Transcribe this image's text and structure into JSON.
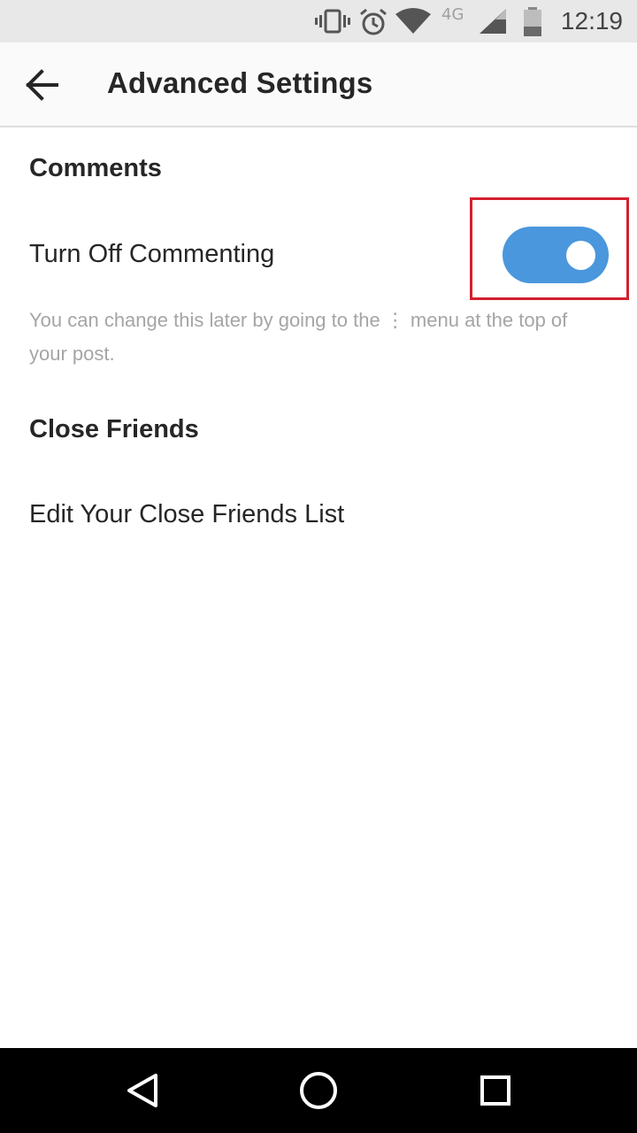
{
  "status_bar": {
    "network_label": "4G",
    "time": "12:19",
    "icons": [
      "vibrate-icon",
      "alarm-icon",
      "wifi-icon",
      "cell-signal-icon",
      "battery-icon"
    ]
  },
  "app_bar": {
    "title": "Advanced Settings",
    "back_icon": "back-arrow-icon"
  },
  "comments": {
    "header": "Comments",
    "turn_off_commenting": {
      "label": "Turn Off Commenting",
      "enabled": true
    },
    "helper_text": "You can change this later by going to the ⋮ menu at the top of your post."
  },
  "close_friends": {
    "header": "Close Friends",
    "edit_list_label": "Edit Your Close Friends List"
  },
  "colors": {
    "toggle_on": "#4a97dd",
    "highlight": "#d32030",
    "text_primary": "#262626",
    "text_secondary": "#a5a5a5"
  },
  "nav_bar": {
    "icons": [
      "nav-back-icon",
      "nav-home-icon",
      "nav-recents-icon"
    ]
  }
}
